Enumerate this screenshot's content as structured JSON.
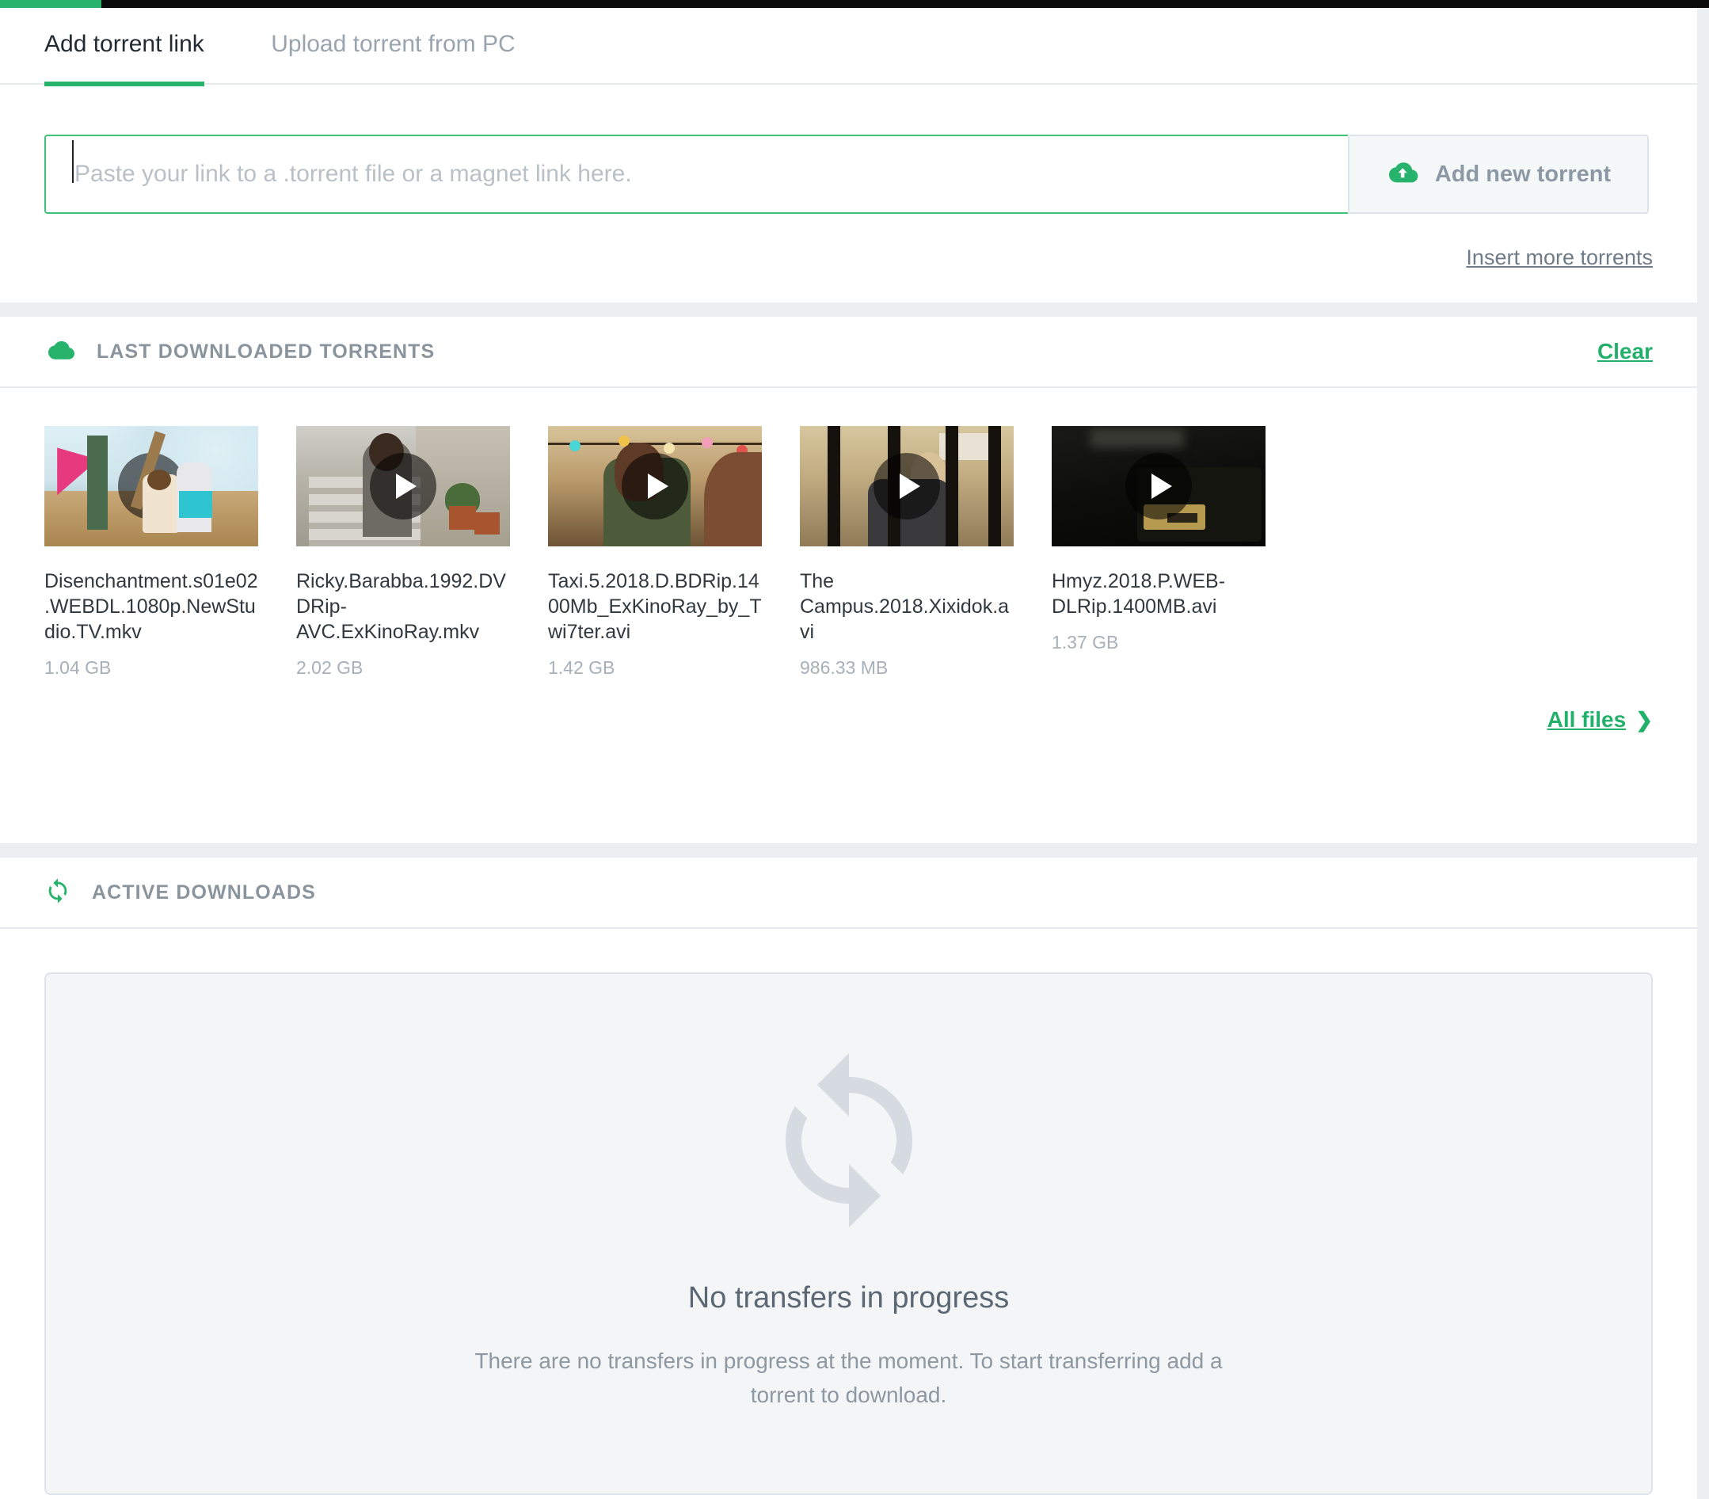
{
  "topbar": {
    "accent_color": "#27b36b",
    "bar_color": "#0b0b0b"
  },
  "theme": {
    "accent": "#23b06b",
    "text": "#31393f",
    "muted": "#8d98a2",
    "page_bg": "#eceff1"
  },
  "add_torrent": {
    "tabs": [
      {
        "label": "Add torrent link",
        "active": true
      },
      {
        "label": "Upload torrent from PC",
        "active": false
      }
    ],
    "input": {
      "value": "",
      "placeholder": "Paste your link to a .torrent file or a magnet link here."
    },
    "add_button": {
      "label": "Add new torrent",
      "icon": "cloud-upload-icon"
    },
    "insert_more_label": "Insert more torrents"
  },
  "last_downloaded": {
    "icon": "cloud-icon",
    "title": "LAST DOWNLOADED TORRENTS",
    "clear_label": "Clear",
    "all_files_label": "All files",
    "all_files_chevron": "❯",
    "items": [
      {
        "name": "Disenchantment.s01e02.WEBDL.1080p.NewStudio.TV.mkv",
        "size": "1.04 GB",
        "play_icon": "play-icon"
      },
      {
        "name": "Ricky.Barabba.1992.DVDRip-AVC.ExKinoRay.mkv",
        "size": "2.02 GB",
        "play_icon": "play-icon"
      },
      {
        "name": "Taxi.5.2018.D.BDRip.1400Mb_ExKinoRay_by_Twi7ter.avi",
        "size": "1.42 GB",
        "play_icon": "play-icon"
      },
      {
        "name": "The Campus.2018.Xixidok.avi",
        "size": "986.33 MB",
        "play_icon": "play-icon"
      },
      {
        "name": "Hmyz.2018.P.WEB-DLRip.1400MB.avi",
        "size": "1.37 GB",
        "play_icon": "play-icon"
      }
    ]
  },
  "active_downloads": {
    "icon": "sync-icon",
    "title": "ACTIVE DOWNLOADS",
    "empty_state": {
      "icon": "sync-large-icon",
      "title": "No transfers in progress",
      "description": "There are no transfers in progress at the moment. To start transferring add a torrent to download."
    }
  }
}
